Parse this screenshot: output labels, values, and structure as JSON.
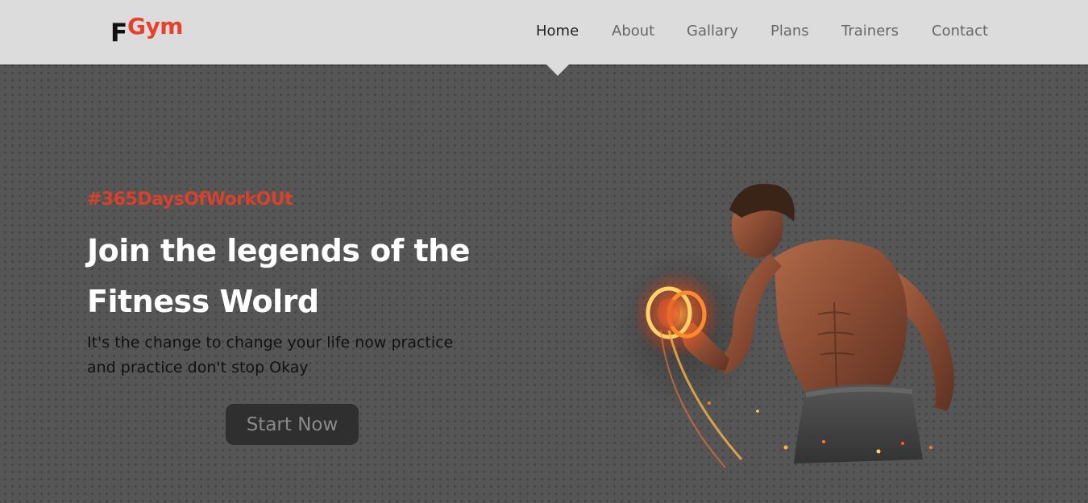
{
  "brand": {
    "letter": "F",
    "name": "Gym"
  },
  "nav": {
    "items": [
      {
        "label": "Home",
        "active": true
      },
      {
        "label": "About"
      },
      {
        "label": "Gallary"
      },
      {
        "label": "Plans"
      },
      {
        "label": "Trainers"
      },
      {
        "label": "Contact"
      }
    ]
  },
  "hero": {
    "hashtag": "#365DaysOfWorkOUt",
    "headline_line1": "Join the legends of the",
    "headline_line2": "Fitness Wolrd",
    "subtext_line1": "It's the change to change your life now practice",
    "subtext_line2": "and practice don't stop Okay",
    "cta_label": "Start Now",
    "image": "flaming-dumbbell-bodybuilder"
  },
  "colors": {
    "accent": "#e8412b",
    "nav_bg": "#dcdcdc",
    "hero_bg": "#565656",
    "button_bg": "#2f2f2f"
  }
}
